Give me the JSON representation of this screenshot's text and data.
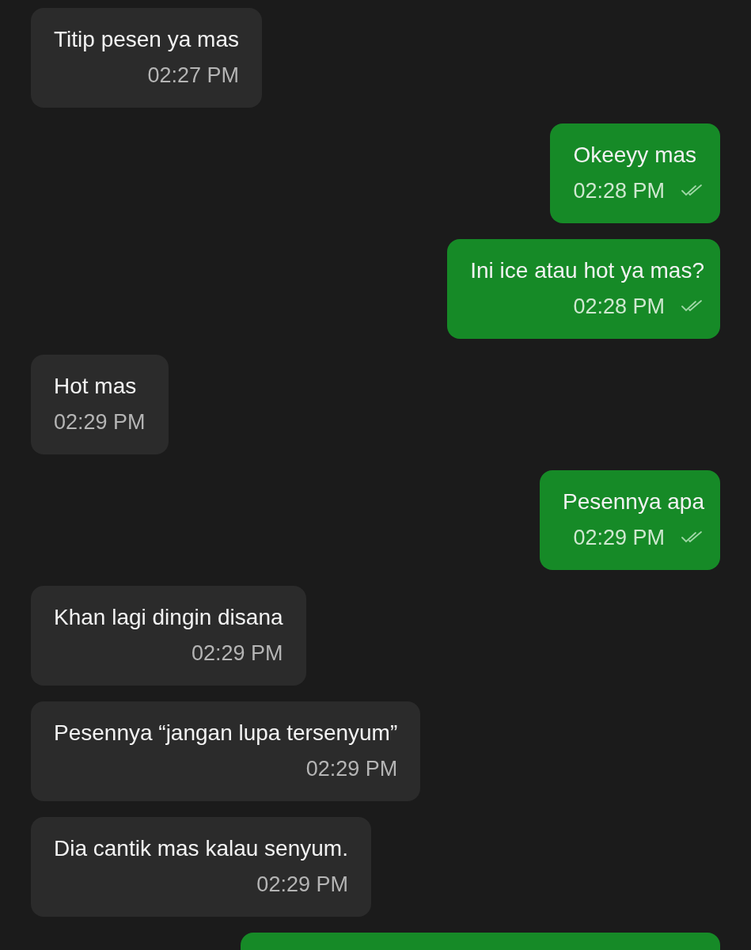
{
  "messages": [
    {
      "kind": "incoming",
      "text": "Titip pesen ya mas",
      "time": "02:27 PM"
    },
    {
      "kind": "outgoing",
      "text": "Okeeyy mas",
      "time": "02:28 PM",
      "read": true
    },
    {
      "kind": "outgoing",
      "text": "Ini ice atau hot ya mas?",
      "time": "02:28 PM",
      "read": true
    },
    {
      "kind": "incoming",
      "text": "Hot mas",
      "time": "02:29 PM"
    },
    {
      "kind": "outgoing",
      "text": "Pesennya apa",
      "time": "02:29 PM",
      "read": true
    },
    {
      "kind": "incoming",
      "text": "Khan lagi dingin disana",
      "time": "02:29 PM"
    },
    {
      "kind": "incoming",
      "text": "Pesennya “jangan lupa tersenyum”",
      "time": "02:29 PM"
    },
    {
      "kind": "incoming",
      "text": "Dia cantik mas kalau senyum.",
      "time": "02:29 PM"
    },
    {
      "kind": "outgoing",
      "partial": true
    }
  ]
}
